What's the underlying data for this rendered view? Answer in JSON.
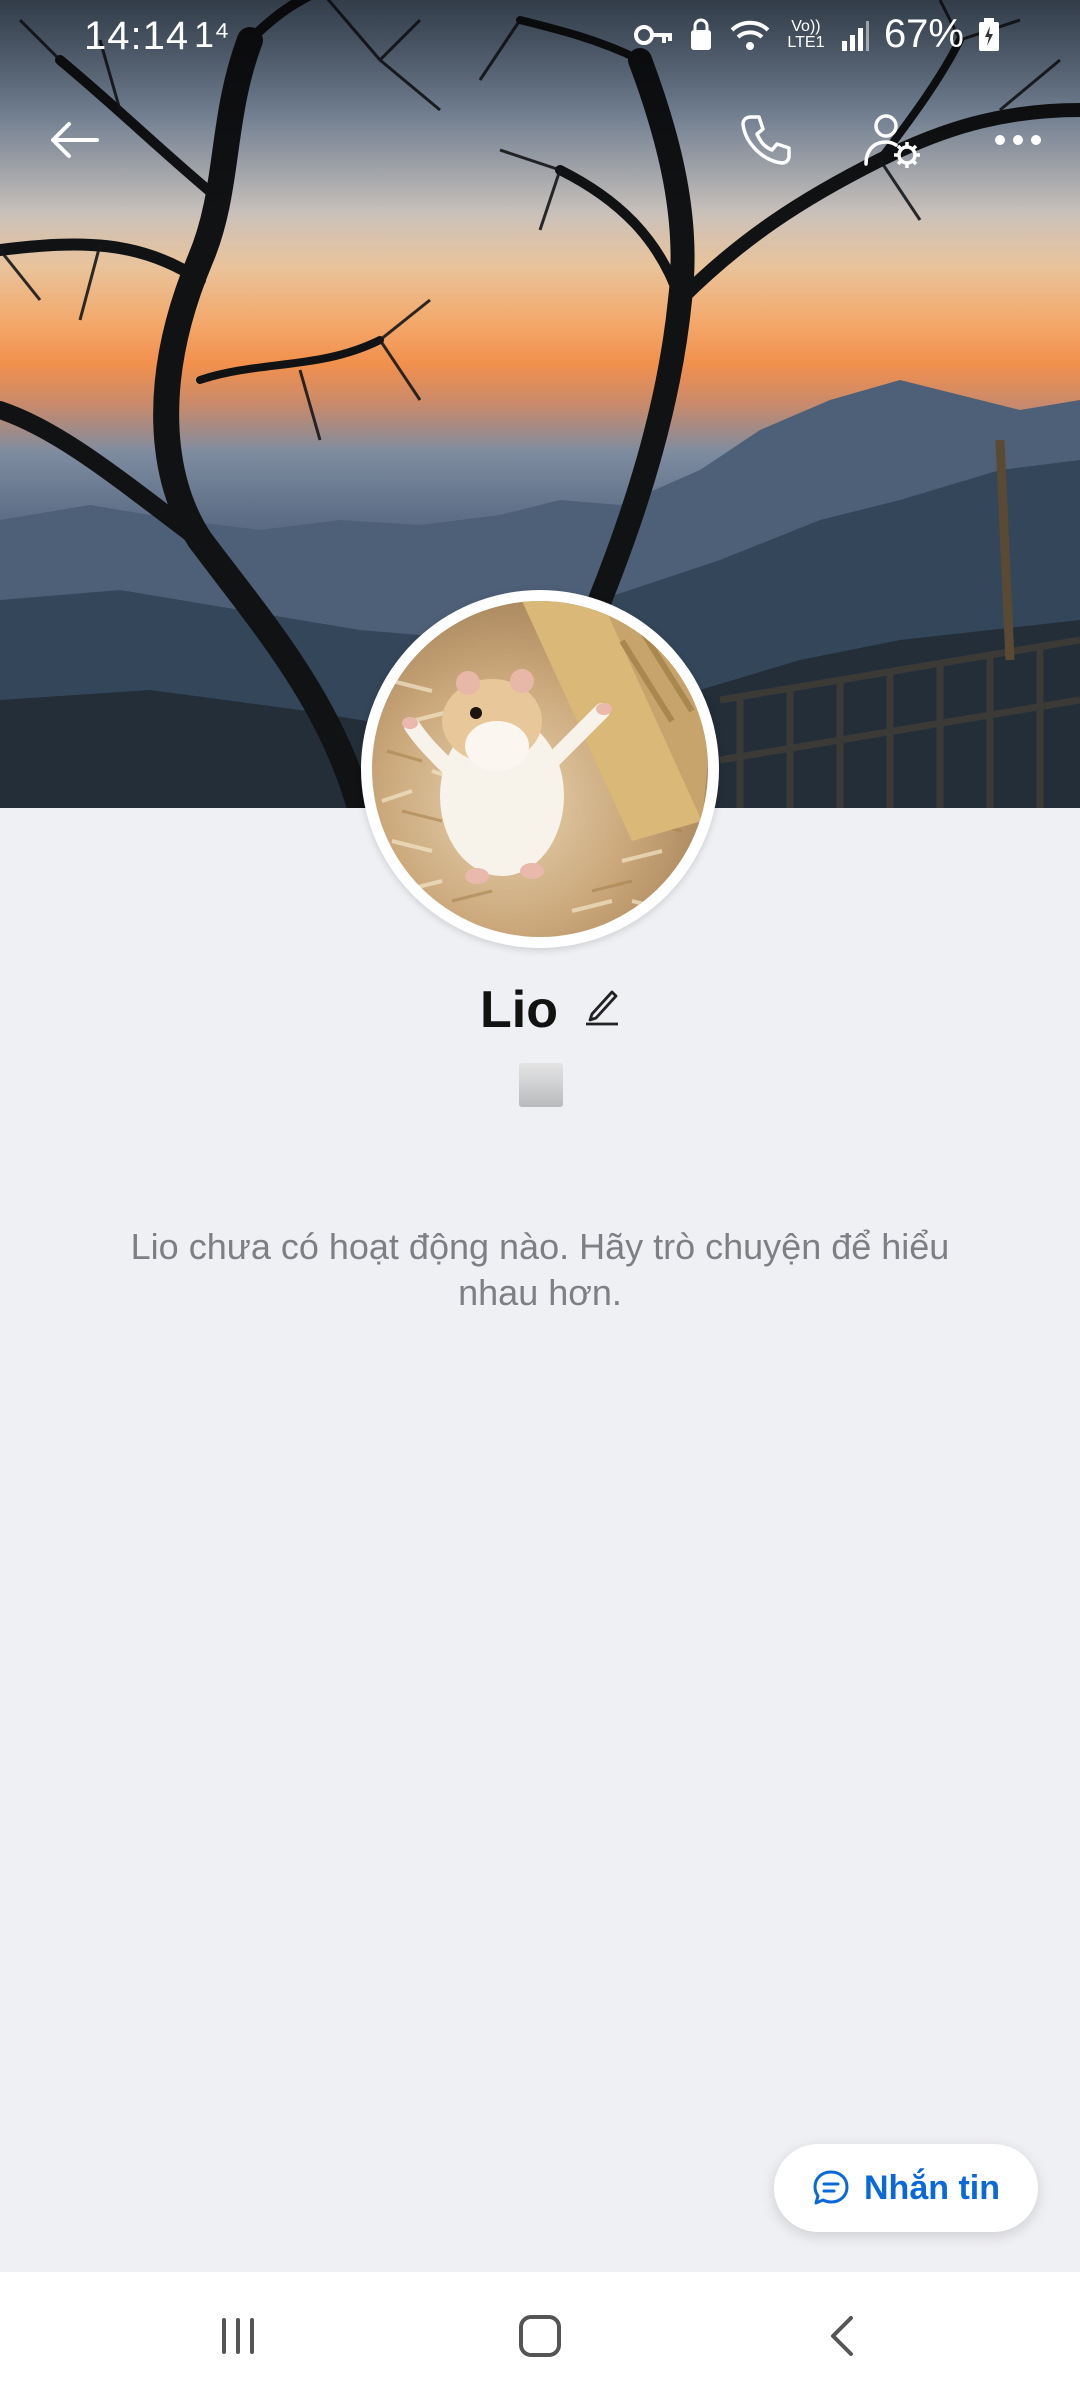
{
  "status_bar": {
    "time": "14:14",
    "misc": "1⁴",
    "network": "Vo)) LTE1",
    "battery": "67%",
    "icons": [
      "key-icon",
      "secure-icon",
      "wifi-icon",
      "signal-icon",
      "battery-icon"
    ]
  },
  "header": {
    "back_icon": "back-arrow-icon",
    "call_icon": "phone-icon",
    "settings_icon": "user-settings-icon",
    "more_icon": "more-icon"
  },
  "profile": {
    "name": "Lio",
    "edit_icon": "pencil-icon",
    "empty_message": "Lio chưa có hoạt động nào. Hãy trò chuyện để hiểu nhau hơn."
  },
  "message_button": {
    "label": "Nhắn tin",
    "icon": "chat-bubble-icon",
    "color": "#0a68d9"
  },
  "nav_bar": {
    "icons": [
      "recent-apps-icon",
      "home-icon",
      "back-icon"
    ]
  }
}
